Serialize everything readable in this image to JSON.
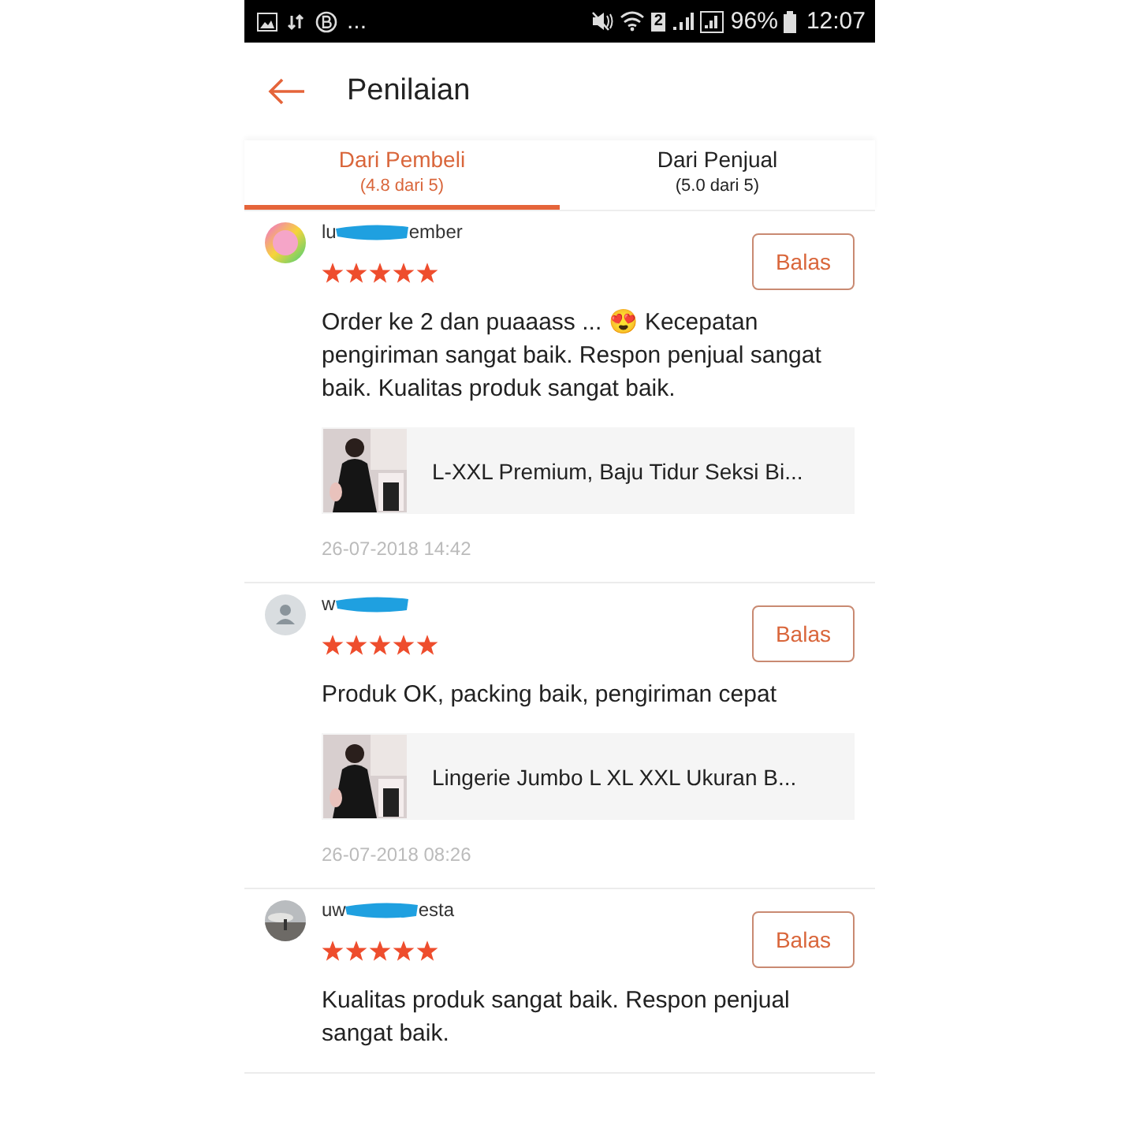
{
  "status_bar": {
    "more": "...",
    "sim": "2",
    "battery": "96%",
    "time": "12:07"
  },
  "header": {
    "title": "Penilaian"
  },
  "tabs": [
    {
      "label": "Dari Pembeli",
      "sub": "(4.8 dari 5)",
      "selected": true
    },
    {
      "label": "Dari Penjual",
      "sub": "(5.0 dari 5)",
      "selected": false
    }
  ],
  "reviews": [
    {
      "avatar": {
        "kind": "logo"
      },
      "name_start": "lu",
      "name_end": "ember",
      "stars": 5,
      "text": "Order ke 2 dan puaaass ... 😍 Kecepatan pengiriman sangat baik. Respon penjual sangat baik. Kualitas produk sangat baik.",
      "product": {
        "kind": "picture",
        "name": "L-XXL Premium, Baju Tidur Seksi Bi..."
      },
      "date": "26-07-2018 14:42",
      "reply": "Balas"
    },
    {
      "avatar": {
        "kind": "default"
      },
      "name_start": "w",
      "stars": 5,
      "text": "Produk OK, packing baik, pengiriman cepat",
      "product": {
        "kind": "picture",
        "name": "Lingerie Jumbo L XL XXL Ukuran B..."
      },
      "date": "26-07-2018 08:26",
      "reply": "Balas"
    },
    {
      "name_start": "uw",
      "name_end": "esta",
      "stars": 5,
      "text": "Kualitas produk sangat baik. Respon penjual sangat baik.",
      "reply": "Balas"
    }
  ]
}
